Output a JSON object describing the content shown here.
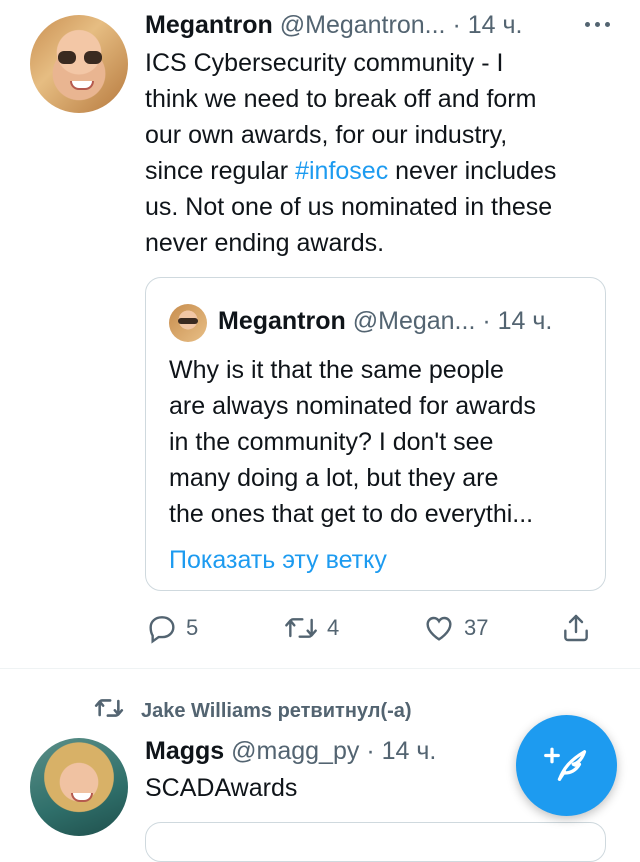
{
  "tweet1": {
    "author_name": "Megantron",
    "author_handle": "@Megantron...",
    "time": "· 14 ч.",
    "text_line1": "ICS Cybersecurity community - I",
    "text_line2": "think we need to break off and form",
    "text_line3": "our own awards, for our industry,",
    "text_line4_pre": "since regular ",
    "text_line4_hashtag": "#infosec",
    "text_line4_post": " never includes",
    "text_line5": "us. Not one of us nominated in these",
    "text_line6": "never ending awards.",
    "quote": {
      "author_name": "Megantron",
      "author_handle": "@Megan...",
      "time": "· 14 ч.",
      "line1": "Why is it that the same people",
      "line2": "are always nominated for awards",
      "line3": "in the community? I don't see",
      "line4": "many doing a lot, but they are",
      "line5": "the ones that get to do everythi...",
      "show_thread": "Показать эту ветку"
    },
    "actions": {
      "reply_count": "5",
      "retweet_count": "4",
      "like_count": "37"
    }
  },
  "retweet_context": {
    "text": "Jake Williams ретвитнул(-а)"
  },
  "tweet2": {
    "author_name": "Maggs",
    "author_handle": "@magg_py",
    "time": "· 14 ч.",
    "text": "SCADAwards"
  },
  "icons": {
    "reply": "reply-icon",
    "retweet": "retweet-icon",
    "like": "heart-icon",
    "share": "share-icon",
    "compose": "compose-tweet-icon",
    "more": "more-icon"
  },
  "colors": {
    "accent": "#1d9bf0",
    "muted": "#536471",
    "text": "#0f1419",
    "border": "#cfd9de"
  }
}
